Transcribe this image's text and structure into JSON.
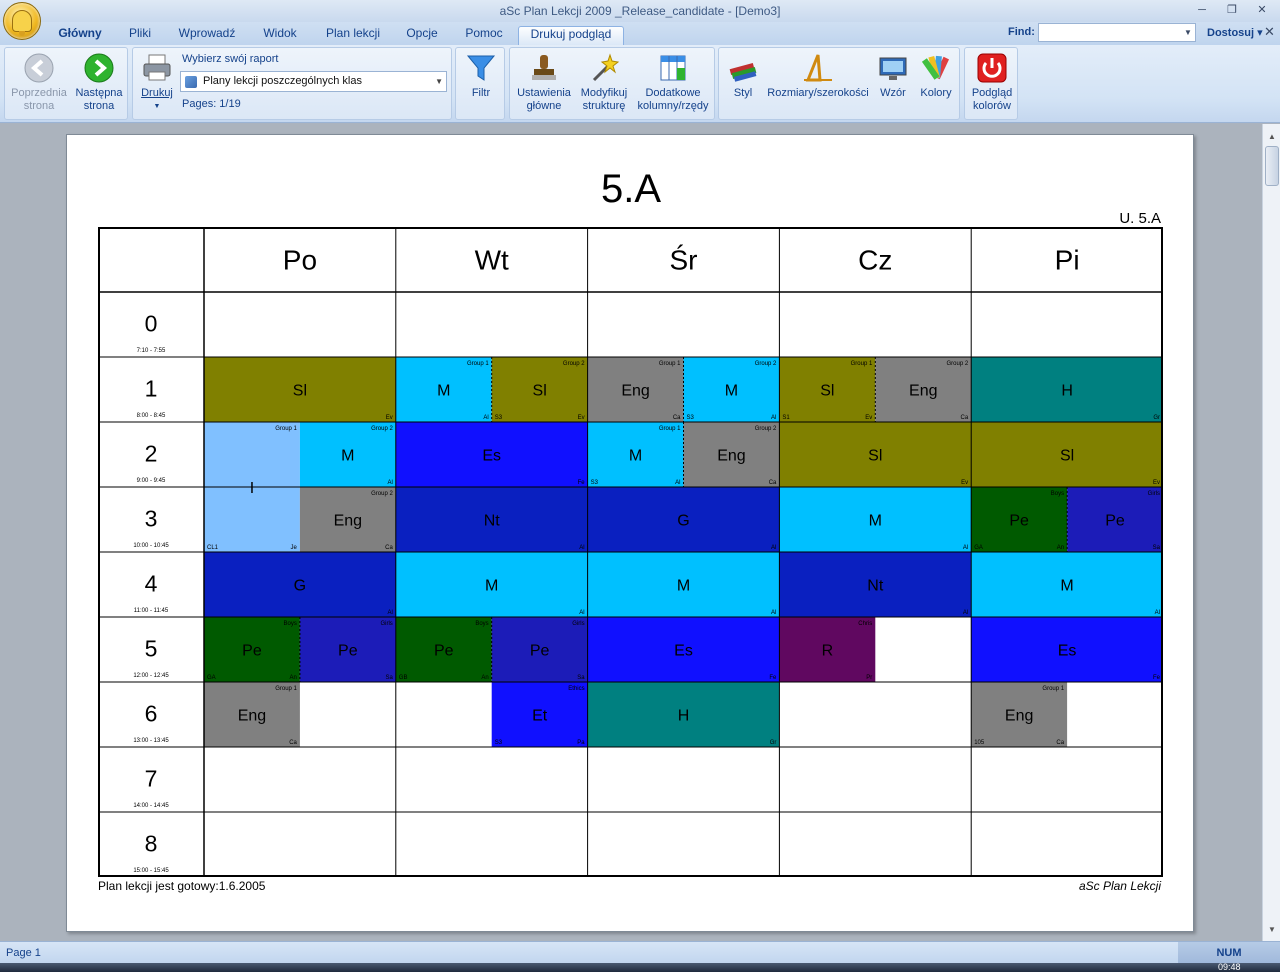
{
  "window": {
    "title": "aSc Plan Lekcji 2009 _Release_candidate - [Demo3]"
  },
  "tabs": [
    {
      "label": "Główny"
    },
    {
      "label": "Pliki"
    },
    {
      "label": "Wprowadź"
    },
    {
      "label": "Widok"
    },
    {
      "label": "Plan lekcji"
    },
    {
      "label": "Opcje"
    },
    {
      "label": "Pomoc"
    },
    {
      "label": "Drukuj podgląd"
    }
  ],
  "find": {
    "label": "Find:",
    "value": ""
  },
  "customize_label": "Dostosuj",
  "ribbon": {
    "prev": [
      "Poprzednia",
      "strona"
    ],
    "next": [
      "Następna",
      "strona"
    ],
    "print": "Drukuj",
    "report_label": "Wybierz swój raport",
    "report_value": "Plany lekcji poszczególnych klas",
    "pages_label": "Pages: 1/19",
    "filter": "Filtr",
    "main_settings": [
      "Ustawienia",
      "główne"
    ],
    "modify_structure": [
      "Modyfikuj",
      "strukturę"
    ],
    "extra_cols": [
      "Dodatkowe",
      "kolumny/rzędy"
    ],
    "style": "Styl",
    "sizes": "Rozmiary/szerokości",
    "pattern": "Wzór",
    "colors": "Kolory",
    "color_preview": [
      "Podgląd",
      "kolorów"
    ]
  },
  "timetable": {
    "class_title": "5.A",
    "room_label": "U. 5.A",
    "days": [
      "Po",
      "Wt",
      "Śr",
      "Cz",
      "Pi"
    ],
    "periods": [
      {
        "num": "0",
        "time": "7:10 - 7:55"
      },
      {
        "num": "1",
        "time": "8:00 - 8:45"
      },
      {
        "num": "2",
        "time": "9:00 - 9:45"
      },
      {
        "num": "3",
        "time": "10:00 - 10:45"
      },
      {
        "num": "4",
        "time": "11:00 - 11:45"
      },
      {
        "num": "5",
        "time": "12:00 - 12:45"
      },
      {
        "num": "6",
        "time": "13:00 - 13:45"
      },
      {
        "num": "7",
        "time": "14:00 - 14:45"
      },
      {
        "num": "8",
        "time": "15:00 - 15:45"
      }
    ],
    "lessons": [
      {
        "day": 0,
        "period": 1,
        "span": 1,
        "x0": 0,
        "x1": 1,
        "subj": "Sl",
        "color": "#808000",
        "br": "Ev"
      },
      {
        "day": 1,
        "period": 1,
        "span": 1,
        "x0": 0,
        "x1": 0.5,
        "subj": "M",
        "color": "#00c0ff",
        "group": "Group 1",
        "br": "Al"
      },
      {
        "day": 1,
        "period": 1,
        "span": 1,
        "x0": 0.5,
        "x1": 1,
        "subj": "Sl",
        "color": "#808000",
        "group": "Group 2",
        "bl": "S3",
        "br": "Ev",
        "dash": true
      },
      {
        "day": 2,
        "period": 1,
        "span": 1,
        "x0": 0,
        "x1": 0.5,
        "subj": "Eng",
        "color": "#808080",
        "group": "Group 1",
        "br": "Ca"
      },
      {
        "day": 2,
        "period": 1,
        "span": 1,
        "x0": 0.5,
        "x1": 1,
        "subj": "M",
        "color": "#00c0ff",
        "group": "Group 2",
        "bl": "S3",
        "br": "Al",
        "dash": true
      },
      {
        "day": 3,
        "period": 1,
        "span": 1,
        "x0": 0,
        "x1": 0.5,
        "subj": "Sl",
        "color": "#808000",
        "group": "Group 1",
        "bl": "S1",
        "br": "Ev"
      },
      {
        "day": 3,
        "period": 1,
        "span": 1,
        "x0": 0.5,
        "x1": 1,
        "subj": "Eng",
        "color": "#808080",
        "group": "Group 2",
        "br": "Ca",
        "dash": true
      },
      {
        "day": 4,
        "period": 1,
        "span": 1,
        "x0": 0,
        "x1": 1,
        "subj": "H",
        "color": "#008080",
        "br": "Gr"
      },
      {
        "day": 0,
        "period": 2,
        "span": 2,
        "x0": 0,
        "x1": 0.5,
        "subj": "I",
        "color": "#80c0ff",
        "group": "Group 1",
        "bl": "CL1",
        "br": "Je"
      },
      {
        "day": 0,
        "period": 2,
        "span": 1,
        "x0": 0.5,
        "x1": 1,
        "subj": "M",
        "color": "#00c0ff",
        "group": "Group 2",
        "br": "Al"
      },
      {
        "day": 1,
        "period": 2,
        "span": 1,
        "x0": 0,
        "x1": 1,
        "subj": "Es",
        "color": "#1010ff",
        "br": "Fe"
      },
      {
        "day": 2,
        "period": 2,
        "span": 1,
        "x0": 0,
        "x1": 0.5,
        "subj": "M",
        "color": "#00c0ff",
        "group": "Group 1",
        "bl": "S3",
        "br": "Al"
      },
      {
        "day": 2,
        "period": 2,
        "span": 1,
        "x0": 0.5,
        "x1": 1,
        "subj": "Eng",
        "color": "#808080",
        "group": "Group 2",
        "br": "Ca",
        "dash": true
      },
      {
        "day": 3,
        "period": 2,
        "span": 1,
        "x0": 0,
        "x1": 1,
        "subj": "Sl",
        "color": "#808000",
        "br": "Ev"
      },
      {
        "day": 4,
        "period": 2,
        "span": 1,
        "x0": 0,
        "x1": 1,
        "subj": "Sl",
        "color": "#808000",
        "br": "Ev"
      },
      {
        "day": 0,
        "period": 3,
        "span": 1,
        "x0": 0.5,
        "x1": 1,
        "subj": "Eng",
        "color": "#808080",
        "group": "Group 2",
        "br": "Ca"
      },
      {
        "day": 1,
        "period": 3,
        "span": 1,
        "x0": 0,
        "x1": 1,
        "subj": "Nt",
        "color": "#0a20c0",
        "br": "Al"
      },
      {
        "day": 2,
        "period": 3,
        "span": 1,
        "x0": 0,
        "x1": 1,
        "subj": "G",
        "color": "#0a20c0",
        "br": "Al"
      },
      {
        "day": 3,
        "period": 3,
        "span": 1,
        "x0": 0,
        "x1": 1,
        "subj": "M",
        "color": "#00c0ff",
        "br": "Al"
      },
      {
        "day": 4,
        "period": 3,
        "span": 1,
        "x0": 0,
        "x1": 0.5,
        "subj": "Pe",
        "color": "#005a00",
        "group": "Boys",
        "bl": "GA",
        "br": "An"
      },
      {
        "day": 4,
        "period": 3,
        "span": 1,
        "x0": 0.5,
        "x1": 1,
        "subj": "Pe",
        "color": "#1c1cb8",
        "group": "Girls",
        "br": "Sa",
        "dash": true
      },
      {
        "day": 0,
        "period": 4,
        "span": 1,
        "x0": 0,
        "x1": 1,
        "subj": "G",
        "color": "#0a20c0",
        "br": "Al"
      },
      {
        "day": 1,
        "period": 4,
        "span": 1,
        "x0": 0,
        "x1": 1,
        "subj": "M",
        "color": "#00c0ff",
        "br": "Al"
      },
      {
        "day": 2,
        "period": 4,
        "span": 1,
        "x0": 0,
        "x1": 1,
        "subj": "M",
        "color": "#00c0ff",
        "br": "Al"
      },
      {
        "day": 3,
        "period": 4,
        "span": 1,
        "x0": 0,
        "x1": 1,
        "subj": "Nt",
        "color": "#0a20c0",
        "br": "Al"
      },
      {
        "day": 4,
        "period": 4,
        "span": 1,
        "x0": 0,
        "x1": 1,
        "subj": "M",
        "color": "#00c0ff",
        "br": "Al"
      },
      {
        "day": 0,
        "period": 5,
        "span": 1,
        "x0": 0,
        "x1": 0.5,
        "subj": "Pe",
        "color": "#005a00",
        "group": "Boys",
        "bl": "GA",
        "br": "An"
      },
      {
        "day": 0,
        "period": 5,
        "span": 1,
        "x0": 0.5,
        "x1": 1,
        "subj": "Pe",
        "color": "#1c1cb8",
        "group": "Girls",
        "br": "Sa",
        "dash": true
      },
      {
        "day": 1,
        "period": 5,
        "span": 1,
        "x0": 0,
        "x1": 0.5,
        "subj": "Pe",
        "color": "#005a00",
        "group": "Boys",
        "bl": "GB",
        "br": "An"
      },
      {
        "day": 1,
        "period": 5,
        "span": 1,
        "x0": 0.5,
        "x1": 1,
        "subj": "Pe",
        "color": "#1c1cb8",
        "group": "Girls",
        "br": "Sa",
        "dash": true
      },
      {
        "day": 2,
        "period": 5,
        "span": 1,
        "x0": 0,
        "x1": 1,
        "subj": "Es",
        "color": "#1010ff",
        "br": "Fe"
      },
      {
        "day": 3,
        "period": 5,
        "span": 1,
        "x0": 0,
        "x1": 0.5,
        "subj": "R",
        "color": "#600860",
        "group": "Chris",
        "br": "Pr"
      },
      {
        "day": 4,
        "period": 5,
        "span": 1,
        "x0": 0,
        "x1": 1,
        "subj": "Es",
        "color": "#1010ff",
        "br": "Fe"
      },
      {
        "day": 0,
        "period": 6,
        "span": 1,
        "x0": 0,
        "x1": 0.5,
        "subj": "Eng",
        "color": "#808080",
        "group": "Group 1",
        "br": "Ca"
      },
      {
        "day": 1,
        "period": 6,
        "span": 1,
        "x0": 0.5,
        "x1": 1,
        "subj": "Et",
        "color": "#1010ff",
        "group": "Ethics",
        "bl": "S3",
        "br": "Pa"
      },
      {
        "day": 2,
        "period": 6,
        "span": 1,
        "x0": 0,
        "x1": 1,
        "subj": "H",
        "color": "#008080",
        "br": "Gr"
      },
      {
        "day": 4,
        "period": 6,
        "span": 1,
        "x0": 0,
        "x1": 0.5,
        "subj": "Eng",
        "color": "#808080",
        "group": "Group 1",
        "bl": "105",
        "br": "Ca"
      }
    ],
    "footer_left": "Plan lekcji jest gotowy:1.6.2005",
    "footer_right": "aSc Plan Lekcji"
  },
  "status": {
    "page": "Page 1",
    "num": "NUM",
    "clock": "09:48"
  }
}
